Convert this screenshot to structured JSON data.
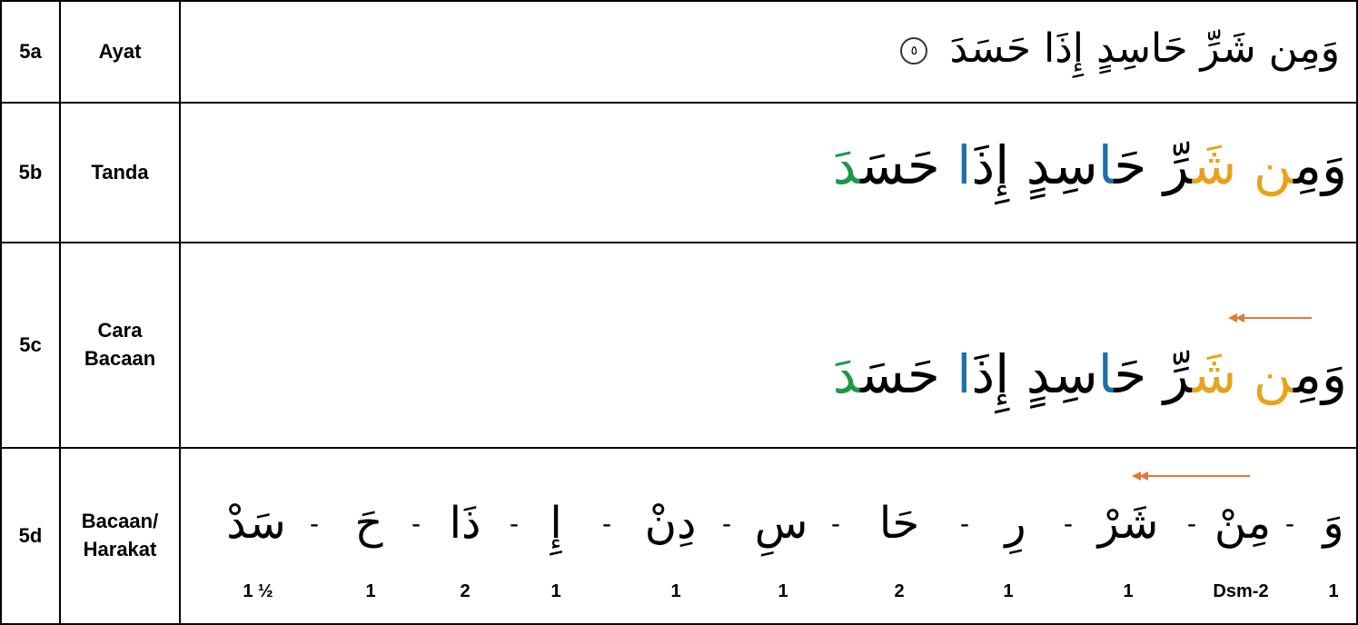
{
  "rows": [
    {
      "id": "5a",
      "label": "Ayat"
    },
    {
      "id": "5b",
      "label": "Tanda"
    },
    {
      "id": "5c",
      "label": "Cara Bacaan"
    },
    {
      "id": "5d",
      "label": "Bacaan/ Harakat"
    }
  ],
  "ayat_text": "وَمِن شَرِّ حَاسِدٍ إِذَا حَسَدَ",
  "ayat_number": "٥",
  "tanda": {
    "parts": [
      "وَمِ",
      "ن",
      " شَ",
      "رّ",
      "ِ حَ",
      "ا",
      "سِدٍ إِذَ",
      "ا",
      " حَسَ",
      "دَ"
    ]
  },
  "cara_bacaan": {
    "parts": [
      "وَمِ",
      "ن",
      " شَ",
      "رّ",
      "ِ حَ",
      "ا",
      "سِدٍ إِذَ",
      "ا",
      " حَسَ",
      "دَ"
    ]
  },
  "syllables": [
    "وَ",
    "مِنْ",
    "شَرْ",
    "رِ",
    "حَا",
    "سِ",
    "دِنْ",
    "إِ",
    "ذَا",
    "حَ",
    "سَدْ"
  ],
  "counts": [
    "1",
    "Dsm-2",
    "1",
    "1",
    "2",
    "1",
    "1",
    "1",
    "2",
    "1",
    "1 ½"
  ],
  "colors": {
    "orange": "#e8a21c",
    "blue": "#1f6fa8",
    "green": "#1a9a4a",
    "arrow": "#e07a3a"
  }
}
